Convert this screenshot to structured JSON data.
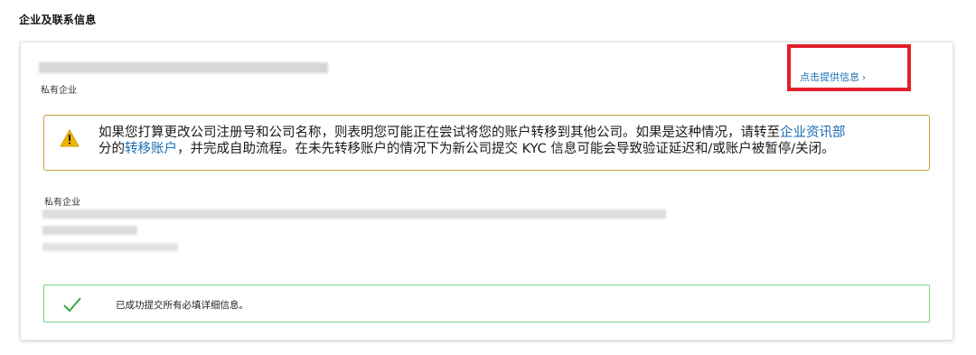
{
  "section": {
    "title": "企业及联系信息"
  },
  "card": {
    "company_type_top": "私有企业",
    "provide_info_link": "点击提供信息",
    "provide_info_chevron": "›",
    "warning": {
      "text_part1": "如果您打算更改公司注册号和公司名称，则表明您可能正在尝试将您的账户转移到其他公司。如果是这种情况，请转至",
      "link1": "企业资讯部",
      "text_part2": "分的",
      "link2": "转移账户",
      "text_part3": "，并完成自助流程。在未先转移账户的情况下为新公司提交 KYC 信息可能会导致验证延迟和/或账户被暂停/关闭。",
      "icon": "warning-triangle-icon"
    },
    "company_type_bottom": "私有企业",
    "success": {
      "text": "已成功提交所有必填详细信息。",
      "icon": "check-icon"
    }
  },
  "colors": {
    "link": "#1a6fb5",
    "highlight_border": "#e2202a",
    "warning_border": "#c8a13a",
    "success_border": "#7bcf7f",
    "warning_icon": "#f0b400",
    "check_icon": "#3aa648"
  }
}
